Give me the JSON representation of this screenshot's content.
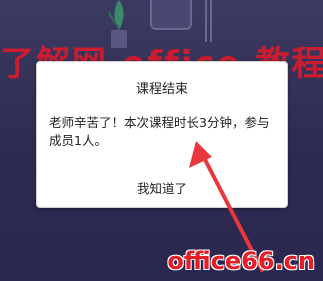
{
  "background": {
    "gradient_top": "#3d3a62",
    "gradient_bottom": "#2a2850",
    "decorations": [
      "plant-lamp",
      "picture-frame",
      "person-silhouette"
    ]
  },
  "watermark_top": {
    "text": "了解网 office 教程网",
    "color": "#e61928"
  },
  "dialog": {
    "title": "课程结束",
    "message": "老师辛苦了！本次课程时长3分钟，参与成员1人。",
    "ok_button_label": "我知道了"
  },
  "annotation": {
    "arrow_color": "#e8383d"
  },
  "watermark_site": {
    "text": "office66.cn",
    "color": "#e61e28"
  }
}
